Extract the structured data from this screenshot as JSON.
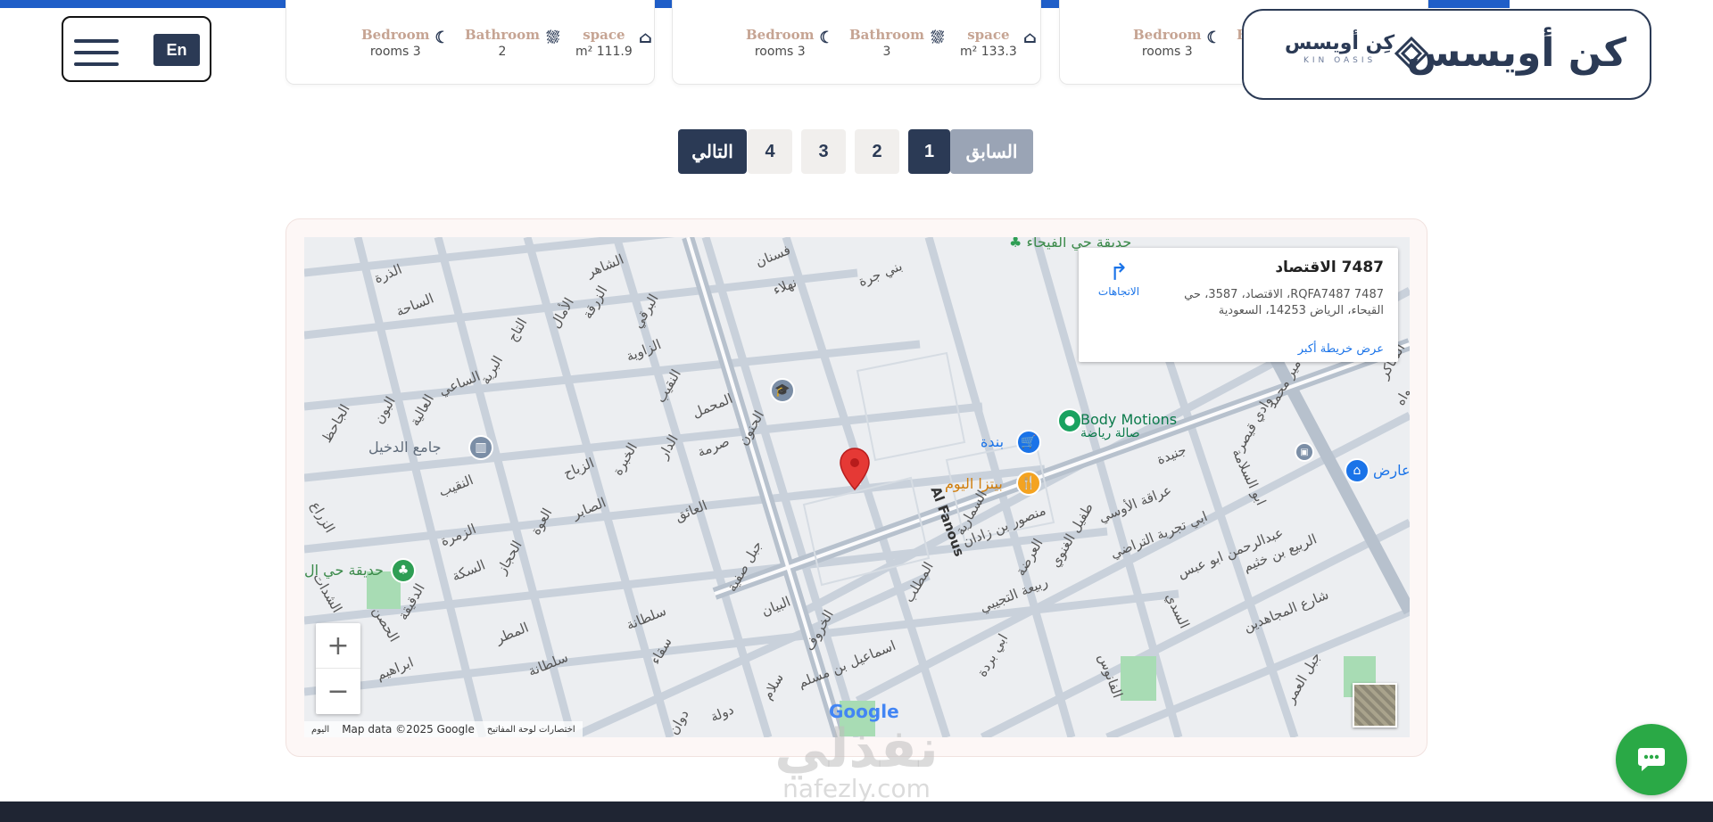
{
  "header": {
    "lang_label": "En",
    "logo_ar": "كن أويسس",
    "logo_small_ar": "كِن أويسس",
    "logo_small_en": "KIN OASIS"
  },
  "cards": [
    {
      "bedroom_title": "Bedroom",
      "bedroom_value": "rooms 3",
      "bathroom_title": "Bathroom",
      "bathroom_value": "2",
      "space_title": "space",
      "space_value": "m² 111.9"
    },
    {
      "bedroom_title": "Bedroom",
      "bedroom_value": "rooms 3",
      "bathroom_title": "Bathroom",
      "bathroom_value": "3",
      "space_title": "space",
      "space_value": "m² 133.3"
    },
    {
      "bedroom_title": "Bedroom",
      "bedroom_value": "rooms 3",
      "bathroom_title": "B"
    }
  ],
  "pagination": {
    "prev": "السابق",
    "pages": [
      "1",
      "2",
      "3",
      "4"
    ],
    "next": "التالي",
    "active": "1"
  },
  "map": {
    "info_title": "7487 الاقتصاد",
    "info_address": "7487 RQFA7487، الاقتصاد، 3587، حي القيحاء، الرياض 14253، السعودية",
    "directions": "الاتجاهات",
    "bigger_map": "عرض خريطة أكبر",
    "zoom_in": "+",
    "zoom_out": "−",
    "google": "Google",
    "attribution": [
      "اليوم",
      "Map data ©2025 Google",
      "اختصارات لوحة المفاتيح"
    ],
    "pois": {
      "garden_top": "حديقة حي الفيحاء",
      "body_motions": "Body Motions",
      "body_motions_sub": "صالة رياضة",
      "panda": "بندة",
      "pizza": "بيتزا اليوم",
      "mosque": "جامع الدخيل",
      "garden_left": "حديقة حي ال",
      "exhibit": "عارض"
    },
    "streets": [
      "الذرة",
      "الساحة",
      "الشاهر",
      "الزرقة",
      "الأمال",
      "التاج",
      "البرقي",
      "الزاوية",
      "فسنان",
      "نهلاء",
      "بني جرة",
      "النقيب",
      "المحمل",
      "الحنون",
      "صرمة",
      "الدار",
      "الساعي",
      "البرية",
      "العالية",
      "البون",
      "الجاحظ",
      "الزباح",
      "الخبرة",
      "الصابر",
      "العائق",
      "العوة",
      "النقيب",
      "الزمرة",
      "السكة",
      "الدقيقة",
      "الحجاز",
      "المطر",
      "جبل صفية",
      "البيان",
      "الخروف",
      "سلطانة",
      "سلطانة",
      "سقاء",
      "اسماعيل بن مسلم",
      "المطلب",
      "Al Fanous",
      "الفانوس",
      "السمارية",
      "منصور بن زادان",
      "العرضة",
      "ربيعة التجيبي",
      "طفيل الغنوي",
      "عراقة الأوسي",
      "جنيدة",
      "ابي تجربة التراضي",
      "وادي قيصر",
      "الأمير محمد",
      "ابو السلامة",
      "عبدالرحمن ابو عبس",
      "الربيع بن خثيم",
      "شارع المجاهدين",
      "جبل العمر",
      "السدي",
      "ابي بردة",
      "الشاكر",
      "واه",
      "ابراهيم",
      "الحصن",
      "الشدات",
      "الزراع",
      "دولة",
      "سلام",
      "دوان"
    ]
  },
  "watermark": {
    "ar": "نفذلي",
    "en": "nafezly.com"
  },
  "colors": {
    "primary": "#2b3a55",
    "accent_blue": "#1f5ec8",
    "chat_green": "#2aa946",
    "tan": "#c6a493"
  }
}
